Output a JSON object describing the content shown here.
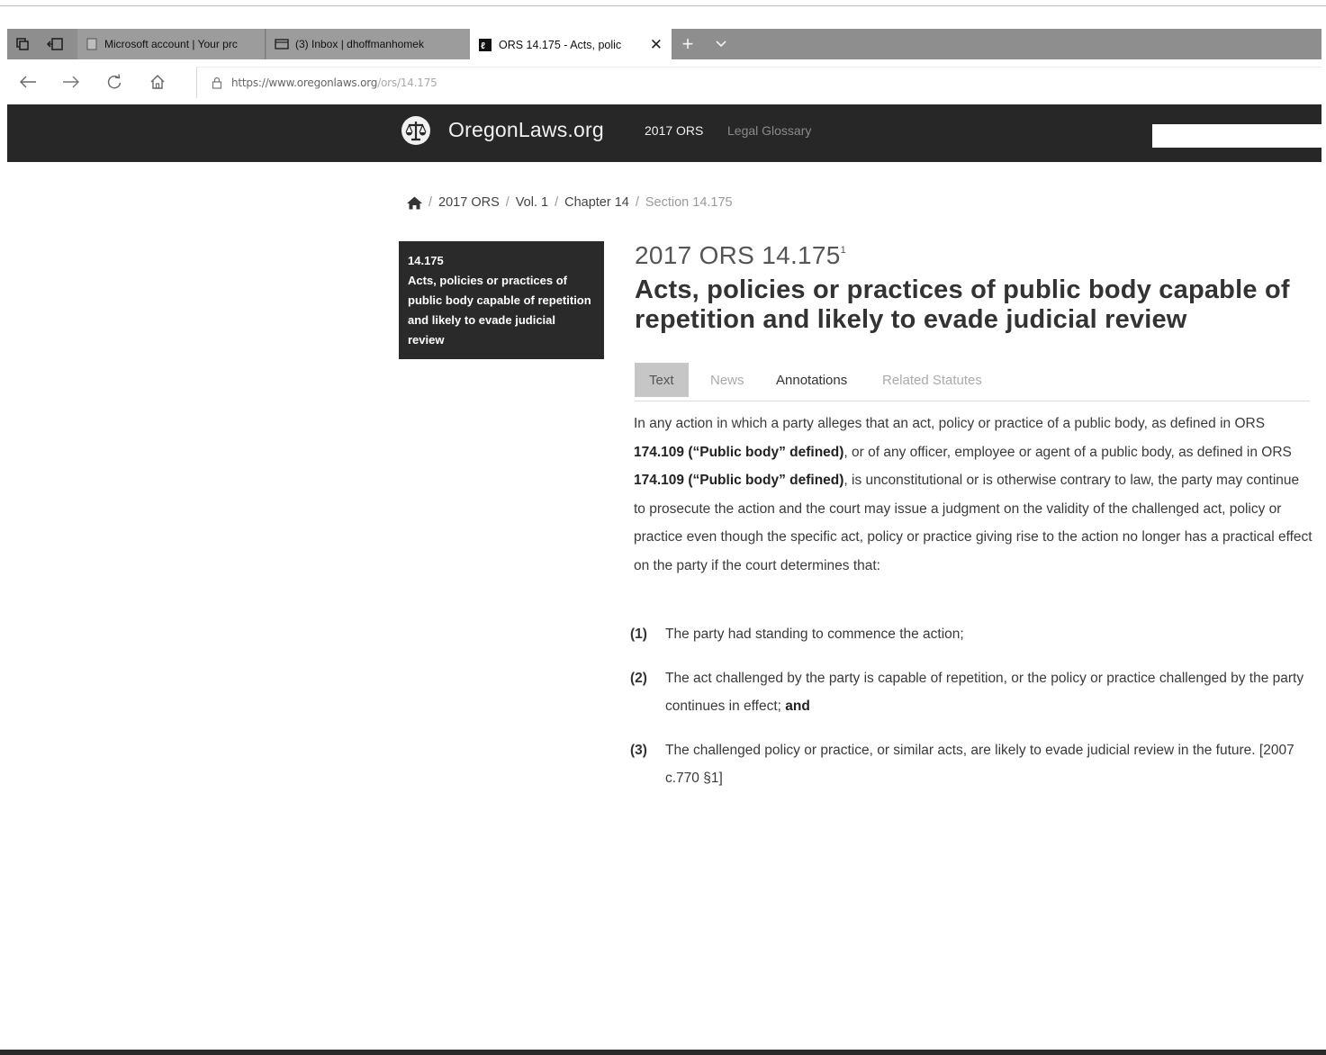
{
  "browser": {
    "tabs": [
      {
        "title": "Microsoft account | Your prc",
        "active": false
      },
      {
        "title": "(3) Inbox | dhoffmanhomek",
        "active": false
      },
      {
        "title": "ORS 14.175 - Acts, polic",
        "active": true
      }
    ],
    "url_prefix": "https://www.oregonlaws.org",
    "url_path": "/ors/14.175"
  },
  "site": {
    "name": "OregonLaws.org",
    "nav": {
      "ors": "2017 ORS",
      "glossary": "Legal Glossary"
    }
  },
  "breadcrumb": {
    "items": [
      "2017 ORS",
      "Vol. 1",
      "Chapter 14"
    ],
    "current": "Section 14.175"
  },
  "sidebar": {
    "number": "14.175",
    "title": "Acts, policies or practices of public body capable of repetition and likely to evade judicial review"
  },
  "main": {
    "title": "2017 ORS 14.175",
    "title_sup": "1",
    "heading": "Acts, policies or practices of public body capable of repetition and likely to evade judicial review",
    "tabs": [
      "Text",
      "News",
      "Annotations",
      "Related Statutes"
    ],
    "body": {
      "p1": "In any action in which a party alleges that an act, policy or practice of a public body, as defined in ORS ",
      "ref1": "174.109 (“Public body” defined)",
      "p2": ", or of any officer, employee or agent of a public body, as defined in ORS ",
      "ref2": "174.109 (“Public body” defined)",
      "p3": ", is unconstitutional or is otherwise contrary to law, the party may continue to prosecute the action and the court may issue a judgment on the validity of the challenged act, policy or practice even though the specific act, policy or practice giving rise to the action no longer has a practical effect on the party if the court determines that:"
    },
    "subsections": [
      {
        "num": "(1)",
        "text": "The party had standing to commence the action;",
        "suffix": ""
      },
      {
        "num": "(2)",
        "text": "The act challenged by the party is capable of repetition, or the policy or practice challenged by the party continues in effect; ",
        "suffix": "and"
      },
      {
        "num": "(3)",
        "text": "The challenged policy or practice, or similar acts, are likely to evade judicial review in the future. [2007 c.770 §1]",
        "suffix": ""
      }
    ]
  },
  "colors": {
    "header_bg": "#272727",
    "sidebar_bg": "#2a2a2a",
    "tab_active_bg": "#c6c6c6",
    "tabstrip_bg": "#8e8e8e"
  }
}
